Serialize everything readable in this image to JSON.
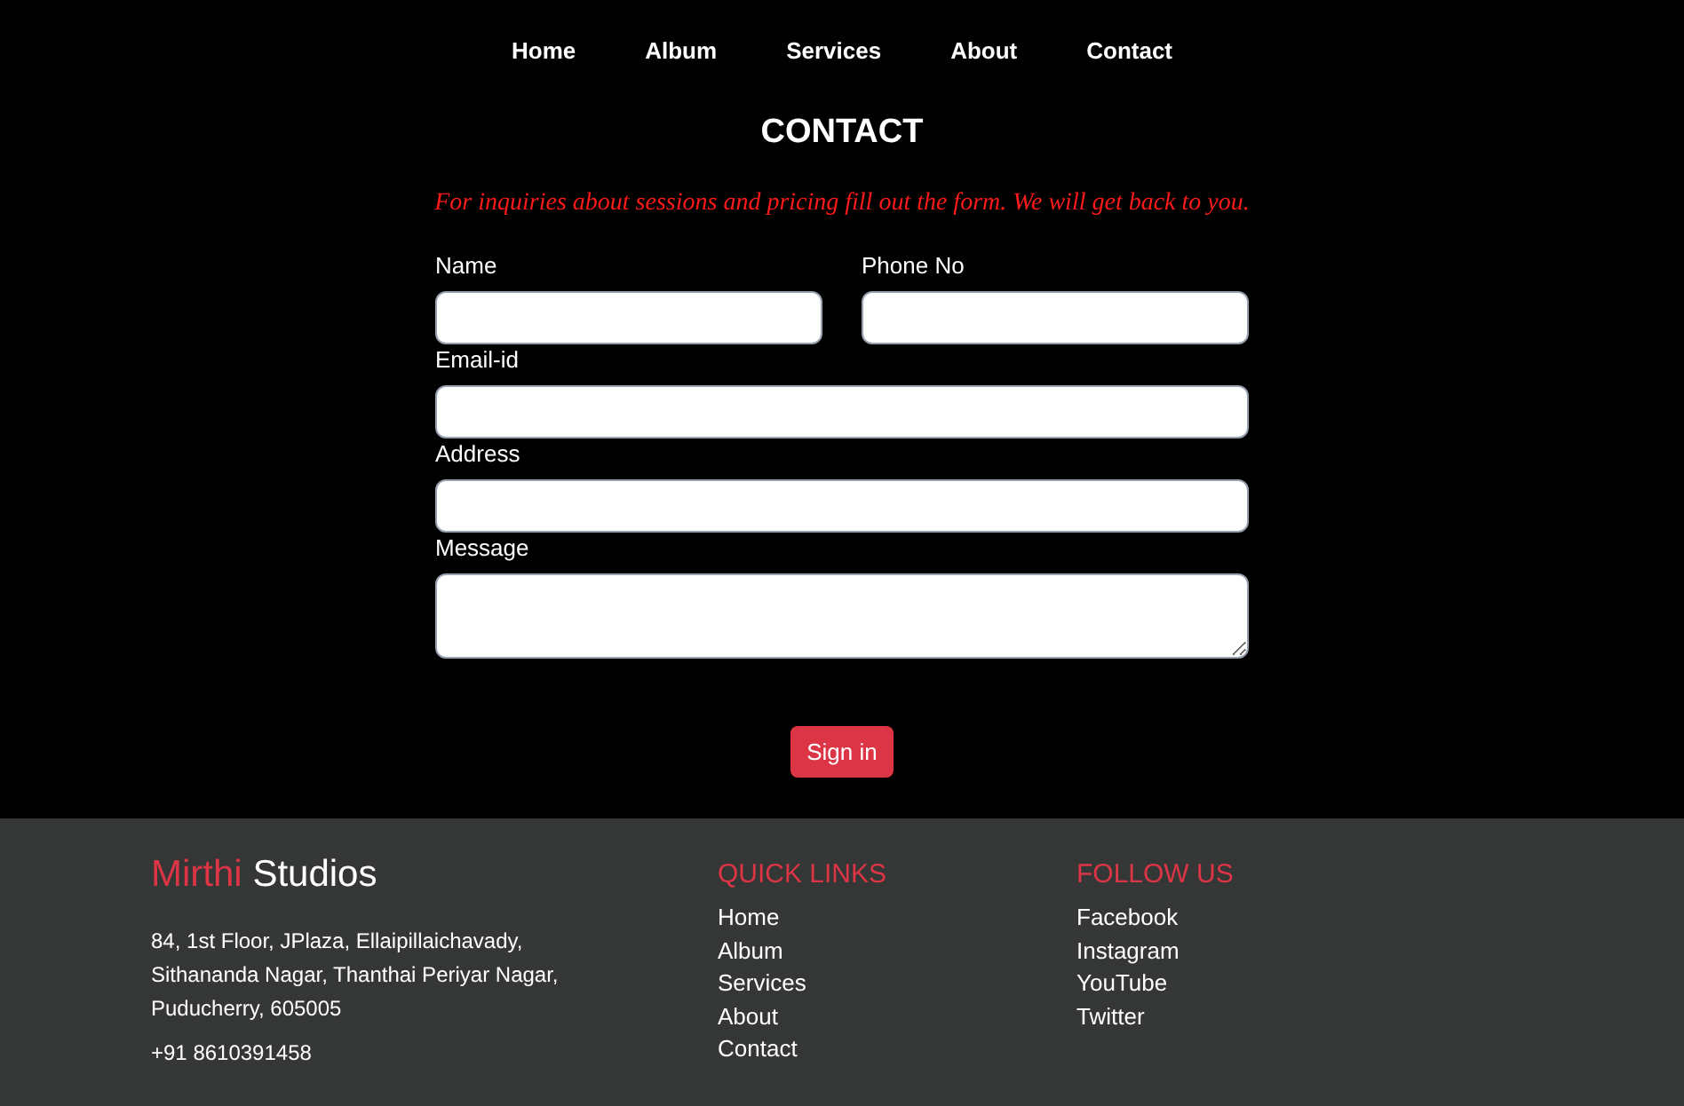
{
  "nav": [
    {
      "label": "Home"
    },
    {
      "label": "Album"
    },
    {
      "label": "Services"
    },
    {
      "label": "About"
    },
    {
      "label": "Contact"
    }
  ],
  "title": "CONTACT",
  "tagline": "For inquiries about sessions and pricing fill out the form. We will get back to you.",
  "form": {
    "fields": [
      {
        "label": "Name",
        "kind": "input"
      },
      {
        "label": "Phone No",
        "kind": "input"
      },
      {
        "label": "Email-id",
        "kind": "input"
      },
      {
        "label": "Address",
        "kind": "input"
      },
      {
        "label": "Message",
        "kind": "textarea"
      }
    ],
    "submit": "Sign in"
  },
  "footer": {
    "brand_accent": "Mirthi",
    "brand_rest": "Studios",
    "address": [
      "84, 1st Floor, JPlaza, Ellaipillaichavady,",
      "Sithananda Nagar, Thanthai Periyar Nagar,",
      "Puducherry, 605005"
    ],
    "phone": "+91 8610391458",
    "quick_links": {
      "heading": "QUICK LINKS",
      "items": [
        "Home",
        "Album",
        "Services",
        "About",
        "Contact"
      ]
    },
    "follow_us": {
      "heading": "FOLLOW US",
      "items": [
        "Facebook",
        "Instagram",
        "YouTube",
        "Twitter"
      ]
    }
  }
}
